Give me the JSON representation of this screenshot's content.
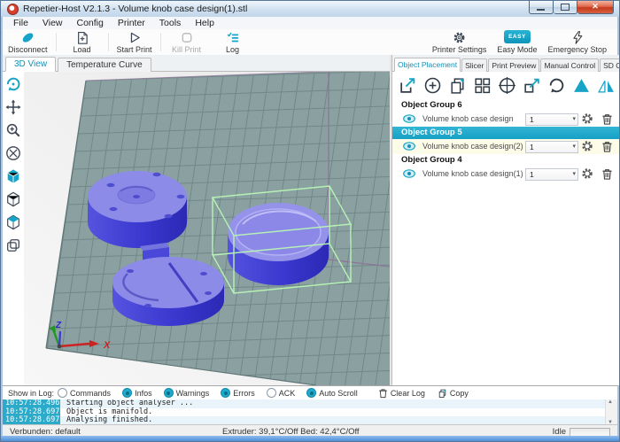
{
  "window": {
    "title": "Repetier-Host V2.1.3 - Volume knob case design(1).stl"
  },
  "menu": {
    "items": [
      "File",
      "View",
      "Config",
      "Printer",
      "Tools",
      "Help"
    ]
  },
  "toolbar": {
    "disconnect": "Disconnect",
    "load": "Load",
    "start_print": "Start Print",
    "kill_print": "Kill Print",
    "log": "Log",
    "printer_settings": "Printer Settings",
    "easy_mode": "Easy Mode",
    "easy_badge": "EASY",
    "emergency_stop": "Emergency Stop"
  },
  "left_tabs": {
    "view_3d": "3D View",
    "temperature_curve": "Temperature Curve"
  },
  "right_tabs": {
    "object_placement": "Object Placement",
    "slicer": "Slicer",
    "print_preview": "Print Preview",
    "manual_control": "Manual Control",
    "sd_card": "SD Card"
  },
  "object_list": {
    "groups": [
      {
        "name": "Object Group 6",
        "selected": false,
        "items": [
          {
            "name": "Volume knob case design",
            "count": "1"
          }
        ]
      },
      {
        "name": "Object Group 5",
        "selected": true,
        "items": [
          {
            "name": "Volume knob case design(2)",
            "count": "1"
          }
        ]
      },
      {
        "name": "Object Group 4",
        "selected": false,
        "items": [
          {
            "name": "Volume knob case design(1)",
            "count": "1"
          }
        ]
      }
    ]
  },
  "scene": {
    "axis_x": "X",
    "axis_z": "Z"
  },
  "log": {
    "show_label": "Show in Log:",
    "filters": [
      {
        "label": "Commands",
        "enabled": false
      },
      {
        "label": "Infos",
        "enabled": true
      },
      {
        "label": "Warnings",
        "enabled": true
      },
      {
        "label": "Errors",
        "enabled": true
      },
      {
        "label": "ACK",
        "enabled": false
      },
      {
        "label": "Auto Scroll",
        "enabled": true
      }
    ],
    "clear_label": "Clear Log",
    "copy_label": "Copy",
    "entries": [
      {
        "time": "10:57:28.496",
        "message": "Starting object analyser ..."
      },
      {
        "time": "10:57:28.697",
        "message": "Object is manifold."
      },
      {
        "time": "10:57:28.697",
        "message": "Analysing finished."
      }
    ]
  },
  "status": {
    "connection": "Verbunden: default",
    "temperatures": "Extruder: 39,1°C/Off Bed: 42,4°C/Off",
    "state": "Idle"
  },
  "colors": {
    "accent": "#18a4c8",
    "selection_box": "#b6f2b6",
    "object_top": "#8d8be8",
    "object_side": "#3a38cf",
    "bed": "#8ba1a1"
  }
}
